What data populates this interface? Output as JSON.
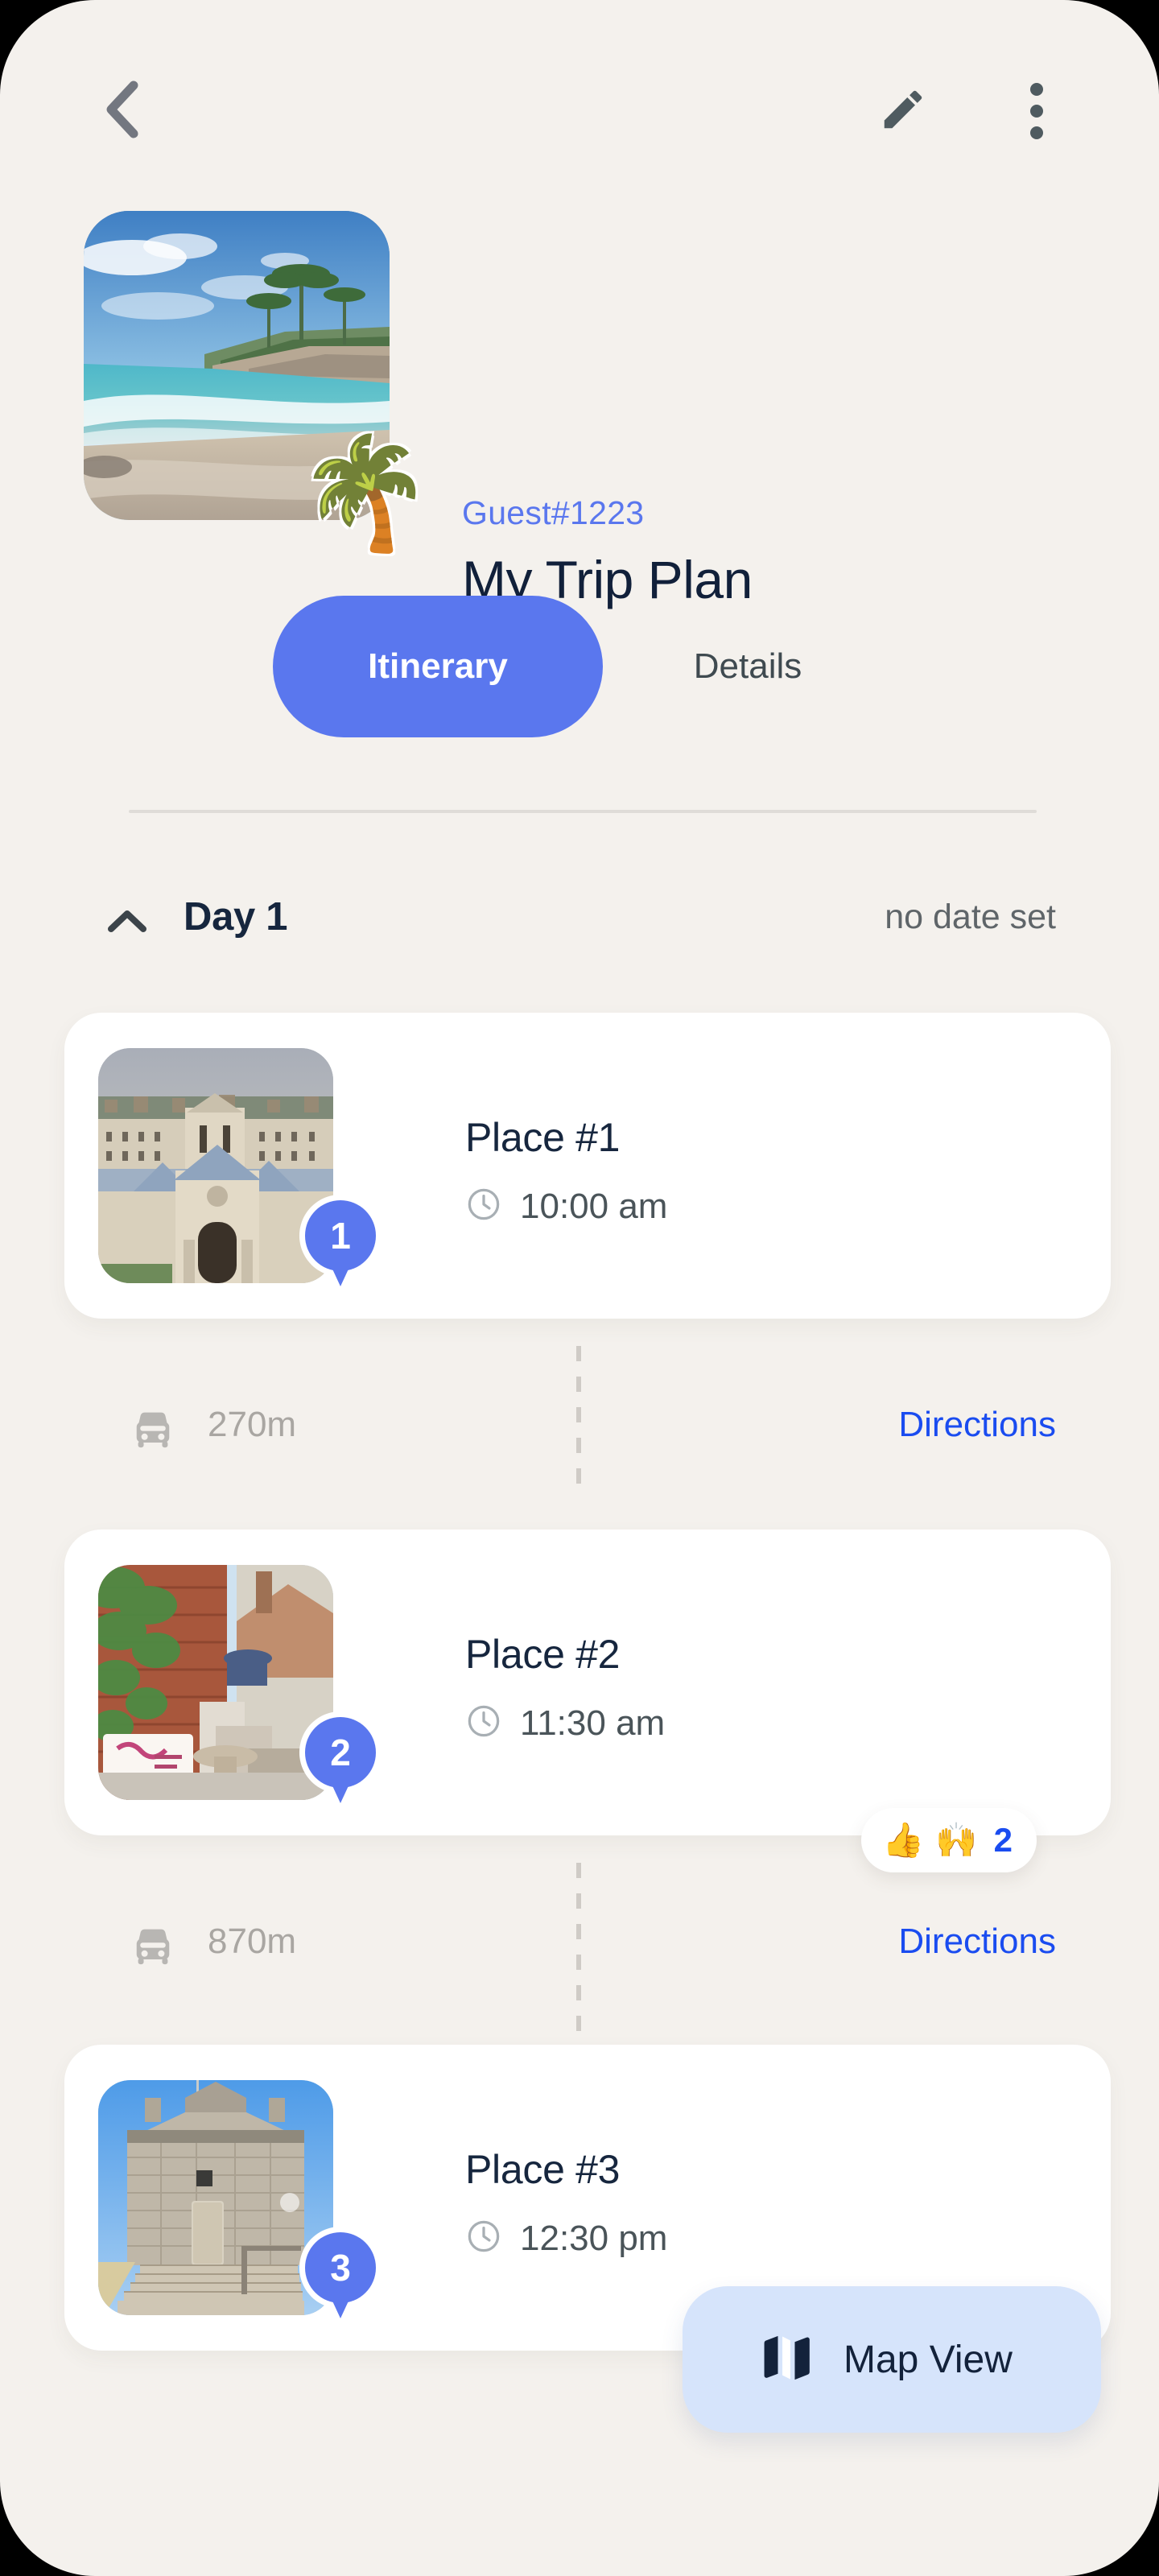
{
  "topbar": {
    "back_icon": "chevron-left-icon",
    "edit_icon": "pencil-icon",
    "menu_icon": "more-vertical-icon"
  },
  "trip": {
    "guest": "Guest#1223",
    "title": "My Trip Plan",
    "cover_emoji": "🌴",
    "cover_alt": "tropical-beach-photo"
  },
  "tabs": [
    {
      "label": "Itinerary",
      "active": true
    },
    {
      "label": "Details",
      "active": false
    }
  ],
  "day": {
    "label": "Day 1",
    "date": "no date set",
    "collapse_icon": "chevron-up-icon"
  },
  "places": [
    {
      "index": "1",
      "name": "Place #1",
      "time": "10:00 am",
      "thumb_alt": "historic-building-photo"
    },
    {
      "index": "2",
      "name": "Place #2",
      "time": "11:30 am",
      "thumb_alt": "market-alley-photo"
    },
    {
      "index": "3",
      "name": "Place #3",
      "time": "12:30 pm",
      "thumb_alt": "stone-fort-stairs-photo"
    }
  ],
  "legs": [
    {
      "distance": "270m",
      "directions_label": "Directions",
      "mode_icon": "car-icon"
    },
    {
      "distance": "870m",
      "directions_label": "Directions",
      "mode_icon": "car-icon"
    }
  ],
  "reaction": {
    "emoji_1": "👍",
    "emoji_2": "🙌",
    "count": "2"
  },
  "map_view": {
    "label": "Map View",
    "icon": "map-icon"
  },
  "colors": {
    "background": "#F4F1ED",
    "accent_blue": "#5A77EE",
    "link_blue": "#1A4CF0",
    "title_navy": "#16263E",
    "muted_gray": "#5F6569",
    "card_white": "#FFFFFF",
    "map_pill": "#D6E4FB"
  }
}
